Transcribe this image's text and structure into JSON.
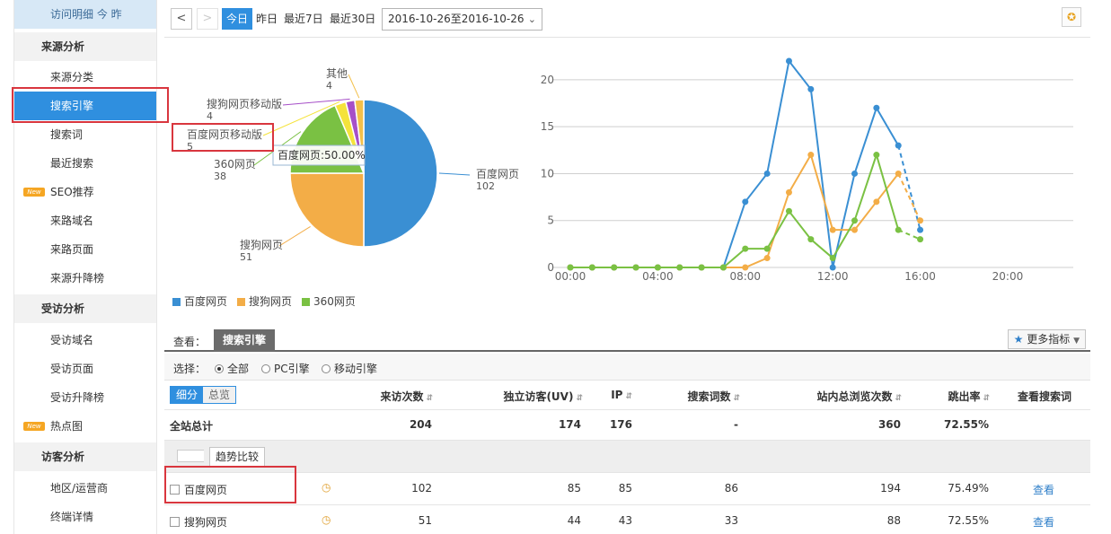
{
  "sidebar": {
    "top_item": "访问明细   今 昨",
    "groups": [
      {
        "label": "来源分析",
        "items": [
          "来源分类",
          "搜索引擎",
          "搜索词",
          "最近搜索",
          "SEO推荐",
          "来路域名",
          "来路页面",
          "来源升降榜"
        ]
      },
      {
        "label": "受访分析",
        "items": [
          "受访域名",
          "受访页面",
          "受访升降榜",
          "热点图"
        ]
      },
      {
        "label": "访客分析",
        "items": [
          "地区/运营商",
          "终端详情"
        ]
      }
    ],
    "new_badge": "New",
    "active_item": "搜索引擎"
  },
  "toolbar": {
    "prev": "<",
    "next": ">",
    "tabs": [
      "今日",
      "昨日",
      "最近7日",
      "最近30日"
    ],
    "active_tab": "今日",
    "date_range": "2016-10-26至2016-10-26",
    "pin_icon": "pin-icon"
  },
  "pie": {
    "tooltip": "百度网页:50.00%",
    "labels": [
      {
        "name": "百度网页",
        "value": "102"
      },
      {
        "name": "搜狗网页",
        "value": "51"
      },
      {
        "name": "360网页",
        "value": "38"
      },
      {
        "name": "百度网页移动版",
        "value": "5"
      },
      {
        "name": "搜狗网页移动版",
        "value": "4"
      },
      {
        "name": "其他",
        "value": "4"
      }
    ]
  },
  "legend": [
    {
      "name": "百度网页",
      "color": "#3a8fd3"
    },
    {
      "name": "搜狗网页",
      "color": "#f3ad47"
    },
    {
      "name": "360网页",
      "color": "#7ac143"
    }
  ],
  "chart_data": [
    {
      "type": "pie",
      "slices": [
        {
          "name": "百度网页",
          "value": 102,
          "color": "#3a8fd3"
        },
        {
          "name": "搜狗网页",
          "value": 51,
          "color": "#f3ad47"
        },
        {
          "name": "360网页",
          "value": 38,
          "color": "#7ac143"
        },
        {
          "name": "百度网页移动版",
          "value": 5,
          "color": "#f5e33b"
        },
        {
          "name": "搜狗网页移动版",
          "value": 4,
          "color": "#a64fc8"
        },
        {
          "name": "其他",
          "value": 4,
          "color": "#f3c04a"
        }
      ]
    },
    {
      "type": "line",
      "x_ticks": [
        "00:00",
        "04:00",
        "08:00",
        "12:00",
        "16:00",
        "20:00"
      ],
      "y_ticks": [
        "0",
        "5",
        "10",
        "15",
        "20"
      ],
      "ylim": [
        0,
        22
      ],
      "xlim": [
        0,
        23
      ],
      "grid": true,
      "series": [
        {
          "name": "百度网页",
          "color": "#3a8fd3",
          "values": [
            0,
            0,
            0,
            0,
            0,
            0,
            0,
            0,
            7,
            10,
            22,
            19,
            0,
            10,
            17,
            13,
            4
          ]
        },
        {
          "name": "搜狗网页",
          "color": "#f3ad47",
          "values": [
            0,
            0,
            0,
            0,
            0,
            0,
            0,
            0,
            0,
            1,
            8,
            12,
            4,
            4,
            7,
            10,
            5
          ]
        },
        {
          "name": "360网页",
          "color": "#7ac143",
          "values": [
            0,
            0,
            0,
            0,
            0,
            0,
            0,
            0,
            2,
            2,
            6,
            3,
            1,
            5,
            12,
            4,
            3
          ]
        }
      ],
      "dashed_last_segment": true
    }
  ],
  "view": {
    "label": "查看：",
    "tab": "搜索引擎",
    "more_metrics": "更多指标"
  },
  "filter": {
    "label": "选择：",
    "options": [
      "全部",
      "PC引擎",
      "移动引擎"
    ],
    "selected": "全部"
  },
  "table": {
    "seg": [
      "细分",
      "总览"
    ],
    "headers": [
      "来访次数",
      "独立访客(UV)",
      "IP",
      "搜索词数",
      "站内总浏览次数",
      "跳出率",
      "查看搜索词"
    ],
    "total": {
      "name": "全站总计",
      "visits": "204",
      "uv": "174",
      "ip": "176",
      "words": "-",
      "pv": "360",
      "bounce": "72.55%"
    },
    "compare_btn": "趋势比较",
    "rows": [
      {
        "name": "百度网页",
        "visits": "102",
        "uv": "85",
        "ip": "85",
        "words": "86",
        "pv": "194",
        "bounce": "75.49%",
        "link": "查看"
      },
      {
        "name": "搜狗网页",
        "visits": "51",
        "uv": "44",
        "ip": "43",
        "words": "33",
        "pv": "88",
        "bounce": "72.55%",
        "link": "查看"
      }
    ]
  }
}
